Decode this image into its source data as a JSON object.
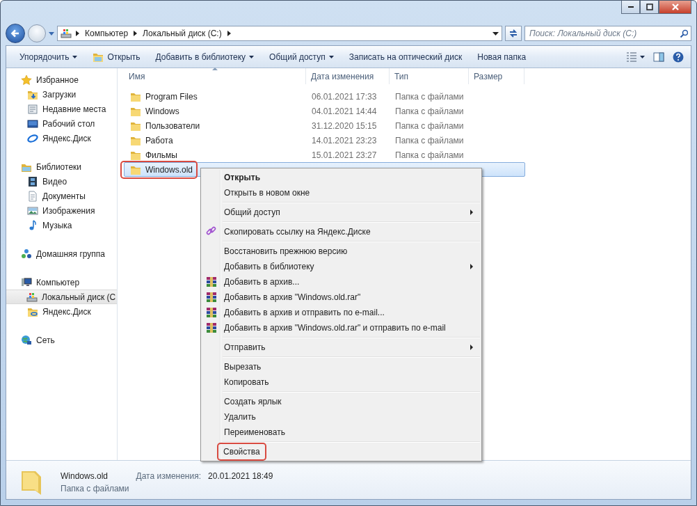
{
  "address_bar": {
    "segments": [
      "Компьютер",
      "Локальный диск (C:)"
    ]
  },
  "search": {
    "placeholder": "Поиск: Локальный диск (C:)"
  },
  "toolbar": {
    "buttons": [
      {
        "label": "Упорядочить",
        "kind": "plain",
        "dropdown": true
      },
      {
        "label": "Открыть",
        "kind": "open",
        "dropdown": false
      },
      {
        "label": "Добавить в библиотеку",
        "kind": "plain",
        "dropdown": true
      },
      {
        "label": "Общий доступ",
        "kind": "plain",
        "dropdown": true
      },
      {
        "label": "Записать на оптический диск",
        "kind": "plain",
        "dropdown": false
      },
      {
        "label": "Новая папка",
        "kind": "plain",
        "dropdown": false
      }
    ]
  },
  "sidebar": {
    "groups": [
      {
        "label": "Избранное",
        "kind": "star",
        "children": [
          {
            "label": "Загрузки",
            "kind": "downloads",
            "selected": false
          },
          {
            "label": "Недавние места",
            "kind": "recent",
            "selected": false
          },
          {
            "label": "Рабочий стол",
            "kind": "desktop",
            "selected": false
          },
          {
            "label": "Яндекс.Диск",
            "kind": "cloud",
            "selected": false
          }
        ]
      },
      {
        "label": "Библиотеки",
        "kind": "library",
        "children": [
          {
            "label": "Видео",
            "kind": "video",
            "selected": false
          },
          {
            "label": "Документы",
            "kind": "documents",
            "selected": false
          },
          {
            "label": "Изображения",
            "kind": "pictures",
            "selected": false
          },
          {
            "label": "Музыка",
            "kind": "music",
            "selected": false
          }
        ]
      },
      {
        "label": "Домашняя группа",
        "kind": "homegroup"
      },
      {
        "label": "Компьютер",
        "kind": "computer",
        "children": [
          {
            "label": "Локальный диск (C",
            "kind": "drive",
            "selected": true
          },
          {
            "label": "Яндекс.Диск",
            "kind": "cloudfolder",
            "selected": false
          }
        ]
      },
      {
        "label": "Сеть",
        "kind": "network"
      }
    ]
  },
  "columns": [
    {
      "label": "Имя",
      "sorted": true
    },
    {
      "label": "Дата изменения",
      "sorted": false
    },
    {
      "label": "Тип",
      "sorted": false
    },
    {
      "label": "Размер",
      "sorted": false
    }
  ],
  "files": [
    {
      "name": "Program Files",
      "date": "06.01.2021 17:33",
      "type": "Папка с файлами",
      "selected": false,
      "highlighted": false
    },
    {
      "name": "Windows",
      "date": "04.01.2021 14:44",
      "type": "Папка с файлами",
      "selected": false,
      "highlighted": false
    },
    {
      "name": "Пользователи",
      "date": "31.12.2020 15:15",
      "type": "Папка с файлами",
      "selected": false,
      "highlighted": false
    },
    {
      "name": "Работа",
      "date": "14.01.2021 23:23",
      "type": "Папка с файлами",
      "selected": false,
      "highlighted": false
    },
    {
      "name": "Фильмы",
      "date": "15.01.2021 23:27",
      "type": "Папка с файлами",
      "selected": false,
      "highlighted": false
    },
    {
      "name": "Windows.old",
      "selected": true,
      "highlighted": true
    }
  ],
  "context_menu": {
    "groups": [
      [
        {
          "label": "Открыть",
          "kind": "plain",
          "default": true,
          "submenu": false,
          "highlighted": false
        },
        {
          "label": "Открыть в новом окне",
          "kind": "plain",
          "default": false,
          "submenu": false,
          "highlighted": false
        }
      ],
      [
        {
          "label": "Общий доступ",
          "kind": "plain",
          "default": false,
          "submenu": true,
          "highlighted": false
        }
      ],
      [
        {
          "label": "Скопировать ссылку на Яндекс.Диске",
          "kind": "link",
          "default": false,
          "submenu": false,
          "highlighted": false
        }
      ],
      [
        {
          "label": "Восстановить прежнюю версию",
          "kind": "plain",
          "default": false,
          "submenu": false,
          "highlighted": false
        },
        {
          "label": "Добавить в библиотеку",
          "kind": "plain",
          "default": false,
          "submenu": true,
          "highlighted": false
        },
        {
          "label": "Добавить в архив...",
          "kind": "archive",
          "default": false,
          "submenu": false,
          "highlighted": false
        },
        {
          "label": "Добавить в архив \"Windows.old.rar\"",
          "kind": "archive",
          "default": false,
          "submenu": false,
          "highlighted": false
        },
        {
          "label": "Добавить в архив и отправить по e-mail...",
          "kind": "archive",
          "default": false,
          "submenu": false,
          "highlighted": false
        },
        {
          "label": "Добавить в архив \"Windows.old.rar\" и отправить по e-mail",
          "kind": "archive",
          "default": false,
          "submenu": false,
          "highlighted": false
        }
      ],
      [
        {
          "label": "Отправить",
          "kind": "plain",
          "default": false,
          "submenu": true,
          "highlighted": false
        }
      ],
      [
        {
          "label": "Вырезать",
          "kind": "plain",
          "default": false,
          "submenu": false,
          "highlighted": false
        },
        {
          "label": "Копировать",
          "kind": "plain",
          "default": false,
          "submenu": false,
          "highlighted": false
        }
      ],
      [
        {
          "label": "Создать ярлык",
          "kind": "plain",
          "default": false,
          "submenu": false,
          "highlighted": false
        },
        {
          "label": "Удалить",
          "kind": "plain",
          "default": false,
          "submenu": false,
          "highlighted": false
        },
        {
          "label": "Переименовать",
          "kind": "plain",
          "default": false,
          "submenu": false,
          "highlighted": false
        }
      ],
      [
        {
          "label": "Свойства",
          "kind": "plain",
          "default": false,
          "submenu": false,
          "highlighted": true
        }
      ]
    ]
  },
  "status": {
    "name": "Windows.old",
    "date_label": "Дата изменения:",
    "date": "20.01.2021 18:49",
    "type": "Папка с файлами"
  }
}
